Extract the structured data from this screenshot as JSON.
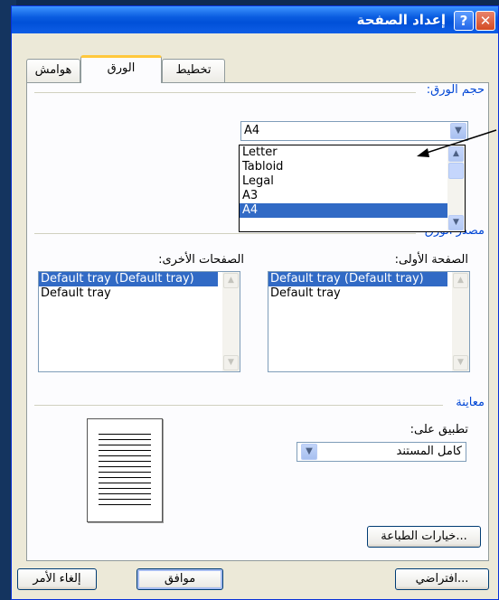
{
  "window": {
    "title": "إعداد الصفحة",
    "help_label": "?",
    "close_label": "✕"
  },
  "tabs": [
    {
      "label": "هوامش"
    },
    {
      "label": "الورق"
    },
    {
      "label": "تخطيط"
    }
  ],
  "paper_size": {
    "group_label": "حجم الورق:",
    "selected": "A4",
    "options": [
      "Letter",
      "Tabloid",
      "Legal",
      "A3",
      "A4"
    ],
    "highlighted": "A4"
  },
  "paper_source": {
    "group_label": "مصدر الورق",
    "first_page": {
      "label": "الصفحة الأولى:",
      "items": [
        "Default tray (Default tray)",
        "Default tray"
      ]
    },
    "other_pages": {
      "label": "الصفحات الأخرى:",
      "items": [
        "Default tray (Default tray)",
        "Default tray"
      ]
    }
  },
  "preview": {
    "group_label": "معاينة",
    "apply_to_label": "تطبيق على:",
    "apply_to_value": "كامل المستند"
  },
  "buttons": {
    "print_options": "خيارات الطباعة...",
    "default": "افتراضي...",
    "ok": "موافق",
    "cancel": "إلغاء الأمر"
  },
  "colors": {
    "accent": "#0046d5",
    "selection": "#316ac5",
    "title_bar": "#0a5ce0",
    "active_tab": "#ffc83c"
  }
}
